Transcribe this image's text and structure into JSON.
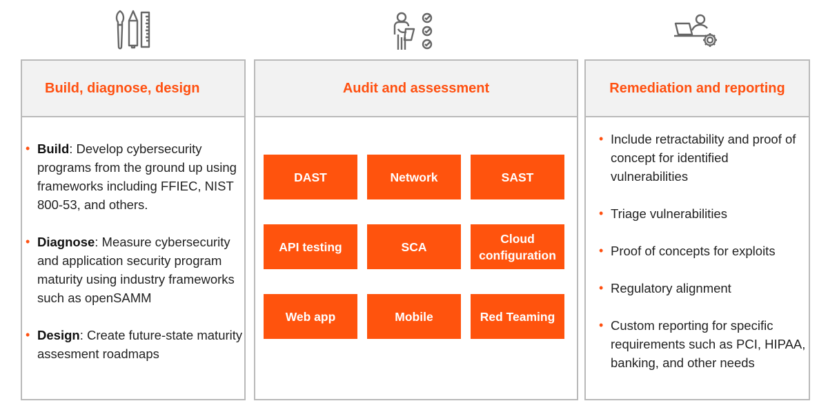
{
  "colors": {
    "accent": "#ff5010",
    "tile": "#ff530d",
    "header_bg": "#f2f2f2",
    "border": "#b9b9b9",
    "icon": "#666666"
  },
  "icons": [
    "brush-pencil-ruler-icon",
    "person-checklist-icon",
    "person-laptop-gear-icon"
  ],
  "panels": [
    {
      "title": "Build, diagnose, design",
      "items": [
        {
          "term": "Build",
          "text": ": Develop cybersecurity programs from the ground up using frameworks including FFIEC, NIST 800-53, and others."
        },
        {
          "term": "Diagnose",
          "text": ": Measure cybersecurity and application security program maturity using industry frameworks such as openSAMM"
        },
        {
          "term": "Design",
          "text": ": Create future-state maturity assesment roadmaps"
        }
      ]
    },
    {
      "title": "Audit and assessment",
      "tiles": [
        "DAST",
        "Network",
        "SAST",
        "API testing",
        "SCA",
        "Cloud configuration",
        "Web app",
        "Mobile",
        "Red Teaming"
      ]
    },
    {
      "title": "Remediation and reporting",
      "items": [
        "Include retractability and proof of concept for identified vulnerabilities",
        "Triage vulnerabilities",
        "Proof of concepts for exploits",
        "Regulatory alignment",
        "Custom reporting for specific requirements such as PCI, HIPAA, banking, and other needs"
      ]
    }
  ]
}
